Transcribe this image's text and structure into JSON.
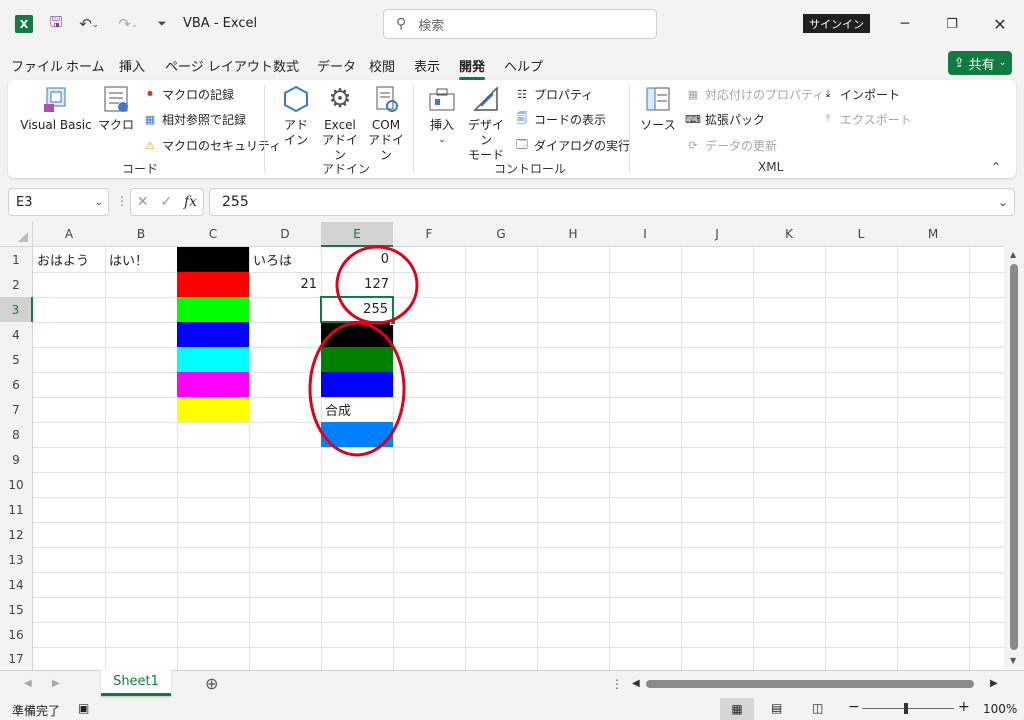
{
  "app": {
    "title": "VBA  -  Excel",
    "logo": "X"
  },
  "search": {
    "placeholder": "検索"
  },
  "signin": "サインイン",
  "share": "共有",
  "menus": [
    "ファイル",
    "ホーム",
    "挿入",
    "ページ レイアウト",
    "数式",
    "データ",
    "校閲",
    "表示",
    "開発",
    "ヘルプ"
  ],
  "ribbon": {
    "code": {
      "visual_basic": "Visual Basic",
      "macro": "マクロ",
      "record": "マクロの記録",
      "relative": "相対参照で記録",
      "security": "マクロのセキュリティ",
      "group": "コード"
    },
    "addins": {
      "addin_l1": "アド",
      "addin_l2": "イン",
      "excel_l1": "Excel",
      "excel_l2": "アドイン",
      "com_l1": "COM",
      "com_l2": "アドイン",
      "group": "アドイン"
    },
    "controls": {
      "insert": "挿入",
      "design_l1": "デザイン",
      "design_l2": "モード",
      "properties": "プロパティ",
      "view_code": "コードの表示",
      "dialog": "ダイアログの実行",
      "group": "コントロール"
    },
    "xml": {
      "source": "ソース",
      "map_props": "対応付けのプロパティ",
      "expansion": "拡張パック",
      "refresh": "データの更新",
      "import": "インポート",
      "export": "エクスポート",
      "group": "XML"
    }
  },
  "formula": {
    "namebox": "E3",
    "value": "255"
  },
  "columns": [
    "A",
    "B",
    "C",
    "D",
    "E",
    "F",
    "G",
    "H",
    "I",
    "J",
    "K",
    "L",
    "M"
  ],
  "rows": [
    "1",
    "2",
    "3",
    "4",
    "5",
    "6",
    "7",
    "8",
    "9",
    "10",
    "11",
    "12",
    "13",
    "14",
    "15",
    "16",
    "17"
  ],
  "cells": {
    "A1": "おはよう",
    "B1": "はい！",
    "D1": "いろは",
    "D2": "21",
    "E1": "0",
    "E2": "127",
    "E3": "255",
    "E7": "合成"
  },
  "colors": {
    "c_fills": [
      "#000000",
      "#ff0000",
      "#00ff00",
      "#0000ff",
      "#00ffff",
      "#ff00ff",
      "#ffff00"
    ],
    "e4": "#000000",
    "e5": "#008000",
    "e6": "#0000ff",
    "e8": "#0080ff",
    "accent": "#107c41",
    "annotation": "#e0001a"
  },
  "sheet": {
    "tab": "Sheet1"
  },
  "status": {
    "ready": "準備完了",
    "zoom": "100%"
  }
}
